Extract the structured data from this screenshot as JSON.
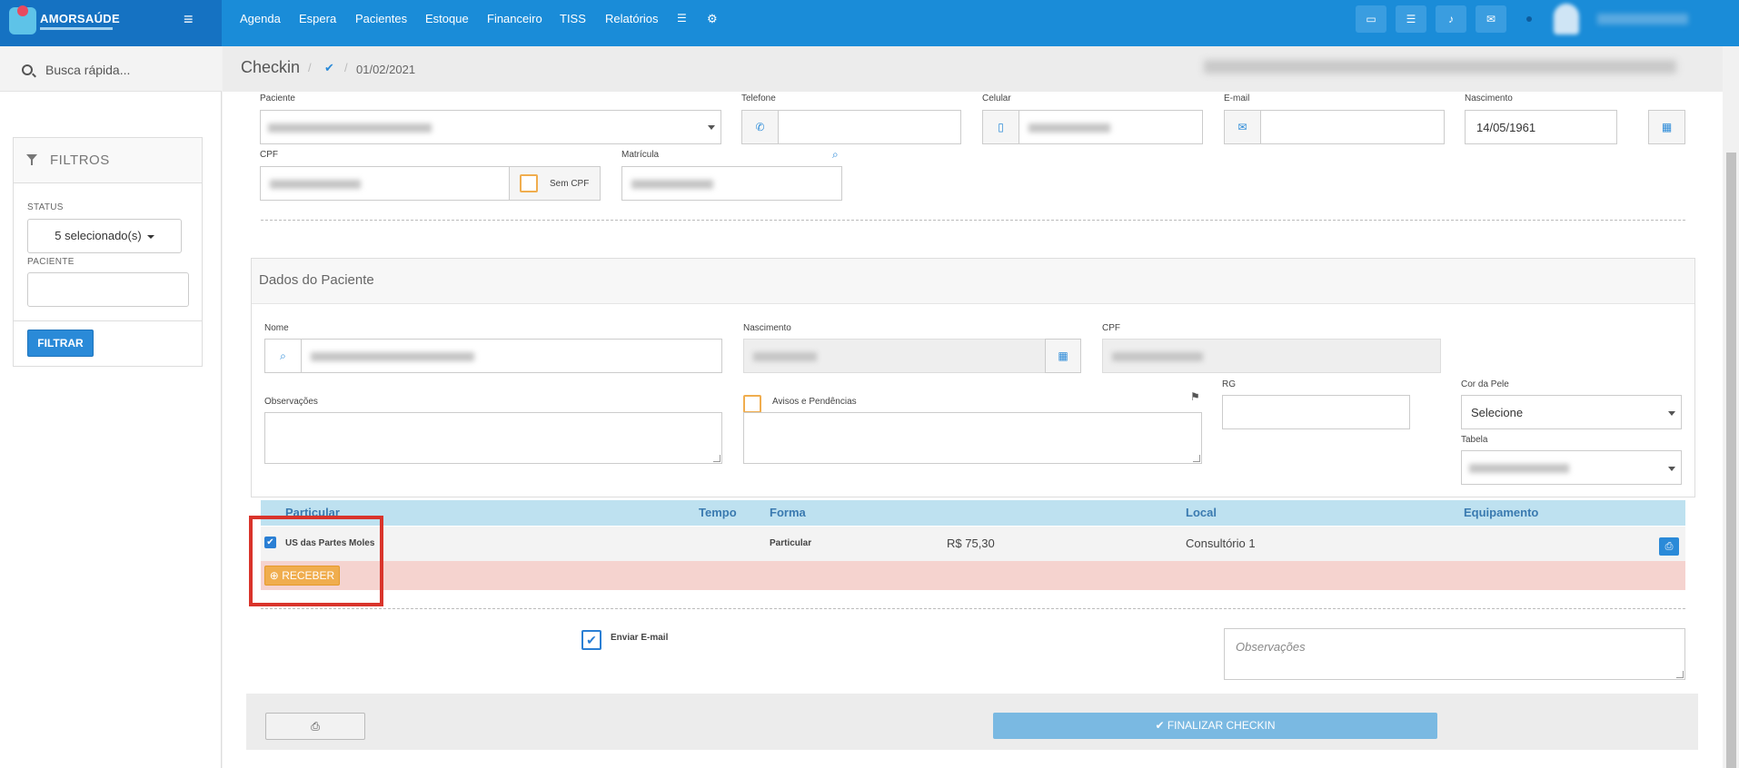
{
  "brand": {
    "name": "AMORSAÚDE"
  },
  "nav": {
    "items": [
      "Agenda",
      "Espera",
      "Pacientes",
      "Estoque",
      "Financeiro",
      "TISS",
      "Relatórios"
    ]
  },
  "sidebar": {
    "search_label": "Busca rápida...",
    "filters_title": "FILTROS",
    "status_label": "STATUS",
    "status_value": "5 selecionado(s)",
    "paciente_label": "PACIENTE",
    "filter_button": "FILTRAR"
  },
  "header": {
    "title": "Checkin",
    "date": "01/02/2021"
  },
  "form": {
    "paciente_label": "Paciente",
    "telefone_label": "Telefone",
    "celular_label": "Celular",
    "email_label": "E-mail",
    "nascimento_label": "Nascimento",
    "nascimento_value": "14/05/1961",
    "cpf_label": "CPF",
    "sem_cpf_label": "Sem CPF",
    "matricula_label": "Matrícula"
  },
  "dados": {
    "title": "Dados do Paciente",
    "nome_label": "Nome",
    "nascimento_label": "Nascimento",
    "cpf_label": "CPF",
    "observacoes_label": "Observações",
    "avisos_label": "Avisos e Pendências",
    "rg_label": "RG",
    "cor_label": "Cor da Pele",
    "cor_value": "Selecione",
    "tabela_label": "Tabela"
  },
  "table": {
    "headers": [
      "Particular",
      "Tempo",
      "Forma",
      "Local",
      "Equipamento"
    ],
    "row": {
      "procedimento": "US das Partes Moles",
      "forma": "Particular",
      "valor": "R$ 75,30",
      "local": "Consultório 1"
    },
    "receber_label": "RECEBER"
  },
  "bottom": {
    "enviar_email_label": "Enviar E-mail",
    "observacoes_placeholder": "Observações"
  },
  "footer": {
    "finalizar_label": "FINALIZAR CHECKIN"
  },
  "colors": {
    "topbar": "#1a8cd8",
    "accent": "#2a8ad8",
    "warning": "#f0ad4e",
    "highlight": "#d9342b"
  }
}
